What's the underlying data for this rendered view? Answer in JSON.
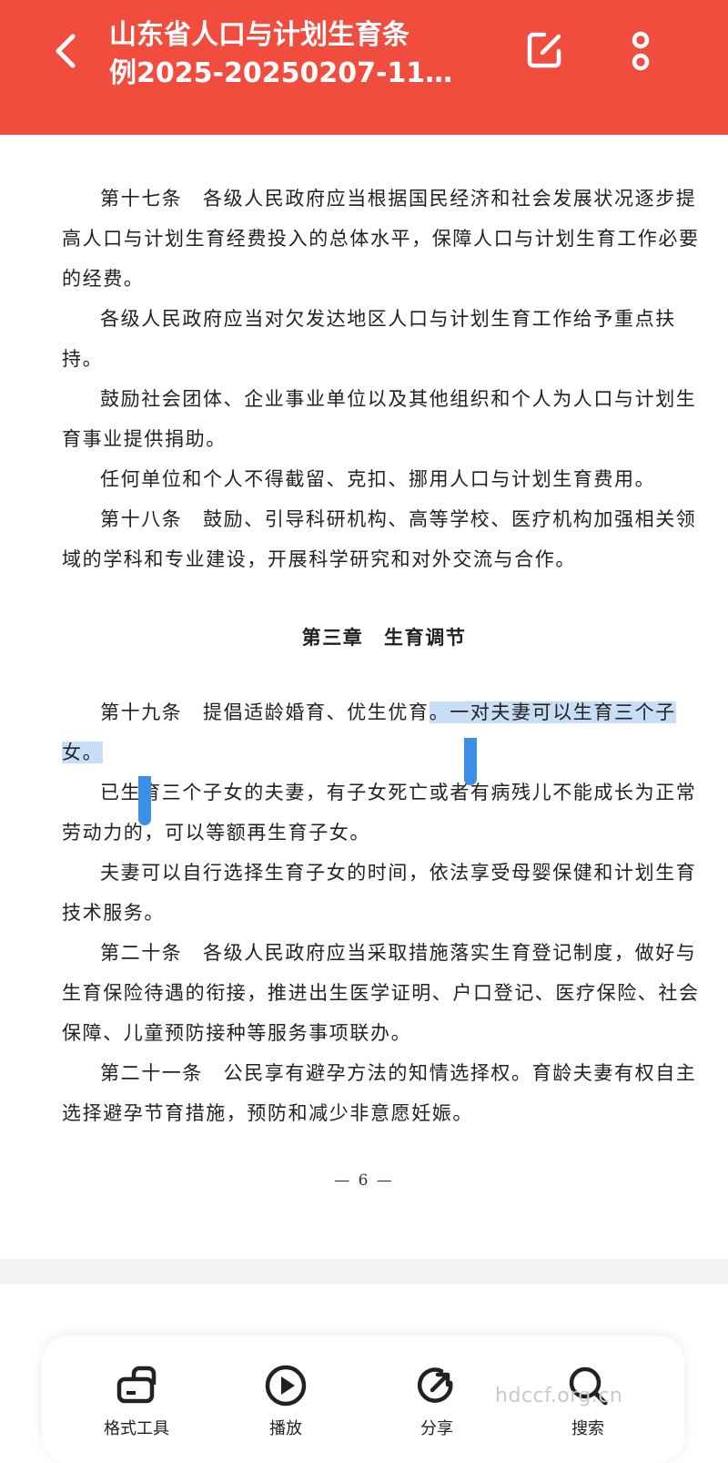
{
  "header": {
    "title_line1": "山东省人口与计划生育条",
    "title_line2": "例2025-20250207-11…",
    "back_icon": "chevron-left-icon",
    "edit_icon": "edit-icon",
    "more_icon": "more-vertical-icon"
  },
  "document": {
    "p1": "第十七条　各级人民政府应当根据国民经济和社会发展状况逐步提高人口与计划生育经费投入的总体水平，保障人口与计划生育工作必要的经费。",
    "p2": "各级人民政府应当对欠发达地区人口与计划生育工作给予重点扶持。",
    "p3": "鼓励社会团体、企业事业单位以及其他组织和个人为人口与计划生育事业提供捐助。",
    "p4": "任何单位和个人不得截留、克扣、挪用人口与计划生育费用。",
    "p5": "第十八条　鼓励、引导科研机构、高等学校、医疗机构加强相关领域的学科和专业建设，开展科学研究和对外交流与合作。",
    "chapter_title": "第三章　生育调节",
    "p6_before": "第十九条　提倡适龄婚育、优生优育",
    "p6_selected": "。一对夫妻可以生育三个子女。",
    "p7": "已生育三个子女的夫妻，有子女死亡或者有病残儿不能成长为正常劳动力的，可以等额再生育子女。",
    "p8": "夫妻可以自行选择生育子女的时间，依法享受母婴保健和计划生育技术服务。",
    "p9": "第二十条　各级人民政府应当采取措施落实生育登记制度，做好与生育保险待遇的衔接，推进出生医学证明、户口登记、医疗保险、社会保障、儿童预防接种等服务事项联办。",
    "p10": "第二十一条　公民享有避孕方法的知情选择权。育龄夫妻有权自主选择避孕节育措施，预防和减少非意愿妊娠。",
    "page_number": "— 6 —"
  },
  "selection_color": "#c8def7",
  "handle_color": "#3d8ee6",
  "accent_color": "#f04d3f",
  "toolbar": {
    "items": [
      {
        "label": "格式工具",
        "icon": "switch-format-icon"
      },
      {
        "label": "播放",
        "icon": "play-icon"
      },
      {
        "label": "分享",
        "icon": "share-icon"
      },
      {
        "label": "搜索",
        "icon": "search-icon"
      }
    ]
  },
  "watermark": "hdccf.org.cn"
}
